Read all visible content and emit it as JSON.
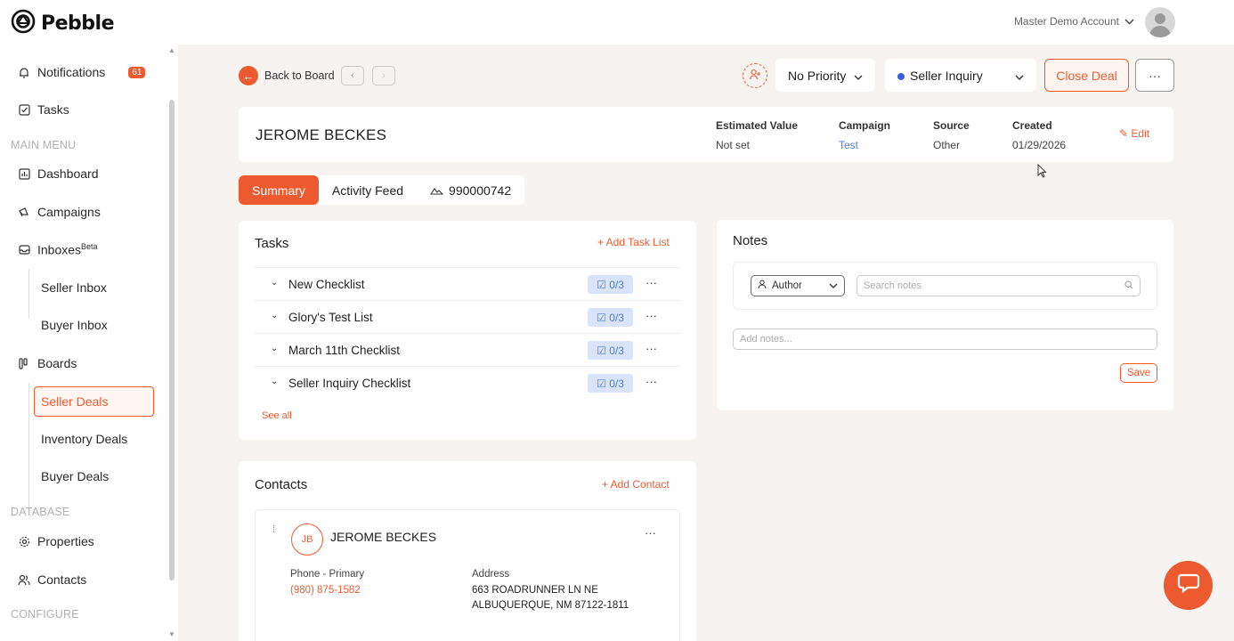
{
  "app": {
    "name": "Pebble",
    "account": "Master Demo Account"
  },
  "sidebar": {
    "notifications": {
      "label": "Notifications",
      "count": "61"
    },
    "tasks": "Tasks",
    "sections": {
      "main": "MAIN MENU",
      "database": "DATABASE",
      "configure": "CONFIGURE"
    },
    "dashboard": "Dashboard",
    "campaigns": "Campaigns",
    "inboxes": {
      "label": "Inboxes",
      "tag": "Beta"
    },
    "seller_inbox": "Seller Inbox",
    "buyer_inbox": "Buyer Inbox",
    "boards": "Boards",
    "seller_deals": "Seller Deals",
    "inventory_deals": "Inventory Deals",
    "buyer_deals": "Buyer Deals",
    "properties": "Properties",
    "contacts": "Contacts"
  },
  "toolbar": {
    "back": "Back to Board",
    "priority": "No Priority",
    "stage": "Seller Inquiry",
    "close_deal": "Close Deal",
    "more": "···"
  },
  "deal": {
    "name": "JEROME BECKES",
    "estimated_value": {
      "label": "Estimated Value",
      "value": "Not set"
    },
    "campaign": {
      "label": "Campaign",
      "value": "Test"
    },
    "source": {
      "label": "Source",
      "value": "Other"
    },
    "created": {
      "label": "Created",
      "value": "01/29/2026"
    },
    "edit": "Edit"
  },
  "tabs": {
    "summary": "Summary",
    "activity": "Activity Feed",
    "phone": "990000742"
  },
  "tasks_card": {
    "title": "Tasks",
    "add": "+ Add Task List",
    "items": [
      {
        "name": "New Checklist",
        "progress": "0/3"
      },
      {
        "name": "Glory's Test List",
        "progress": "0/3"
      },
      {
        "name": "March 11th Checklist",
        "progress": "0/3"
      },
      {
        "name": "Seller Inquiry Checklist",
        "progress": "0/3"
      }
    ],
    "see_all": "See all"
  },
  "notes_card": {
    "title": "Notes",
    "author": "Author",
    "search_placeholder": "Search notes",
    "add_placeholder": "Add notes...",
    "save": "Save"
  },
  "contacts_card": {
    "title": "Contacts",
    "add": "+ Add Contact",
    "contact": {
      "initials": "JB",
      "name": "JEROME BECKES",
      "phone_label": "Phone - Primary",
      "phone": "(980) 875-1582",
      "address_label": "Address",
      "address_line1": "663 ROADRUNNER LN NE",
      "address_line2": "ALBUQUERQUE, NM 87122-1811"
    }
  },
  "colors": {
    "accent": "#ee5a2f",
    "link": "#4a7be6",
    "stage_dot": "#3b5ee0"
  }
}
